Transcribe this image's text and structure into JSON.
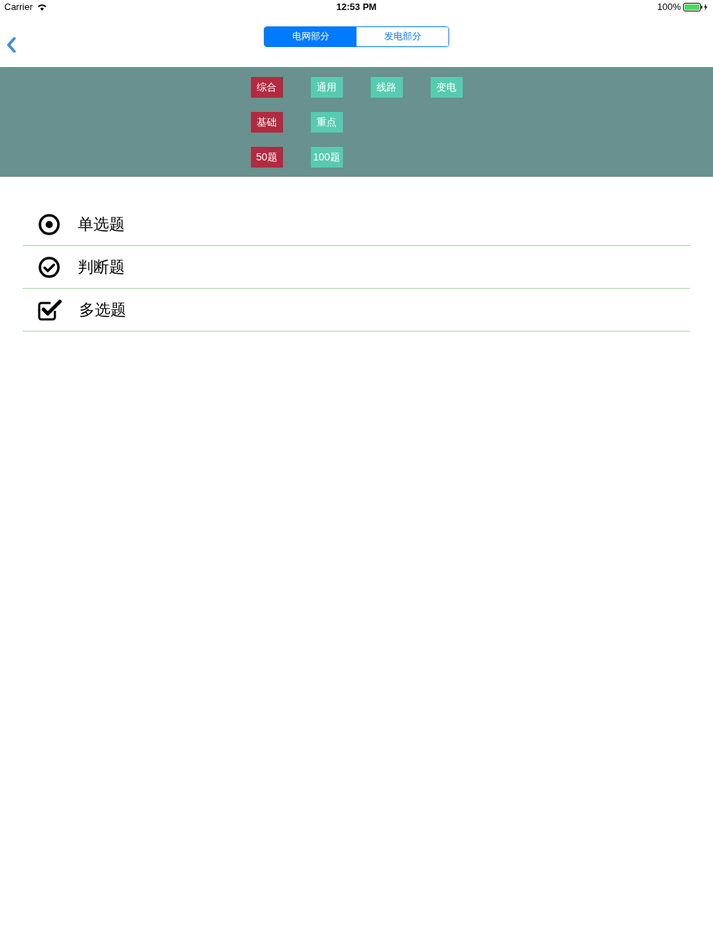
{
  "status_bar": {
    "carrier": "Carrier",
    "time": "12:53 PM",
    "battery": "100%"
  },
  "segments": [
    {
      "label": "电网部分",
      "selected": true
    },
    {
      "label": "发电部分",
      "selected": false
    }
  ],
  "filter_rows": [
    [
      {
        "label": "综合",
        "selected": true
      },
      {
        "label": "通用",
        "selected": false
      },
      {
        "label": "线路",
        "selected": false
      },
      {
        "label": "变电",
        "selected": false
      }
    ],
    [
      {
        "label": "基础",
        "selected": true
      },
      {
        "label": "重点",
        "selected": false
      }
    ],
    [
      {
        "label": "50题",
        "selected": true
      },
      {
        "label": "100题",
        "selected": false
      }
    ]
  ],
  "question_types": [
    {
      "kind": "radio",
      "label": "单选题"
    },
    {
      "kind": "judge",
      "label": "判断题"
    },
    {
      "kind": "checkbox",
      "label": "多选题"
    }
  ]
}
